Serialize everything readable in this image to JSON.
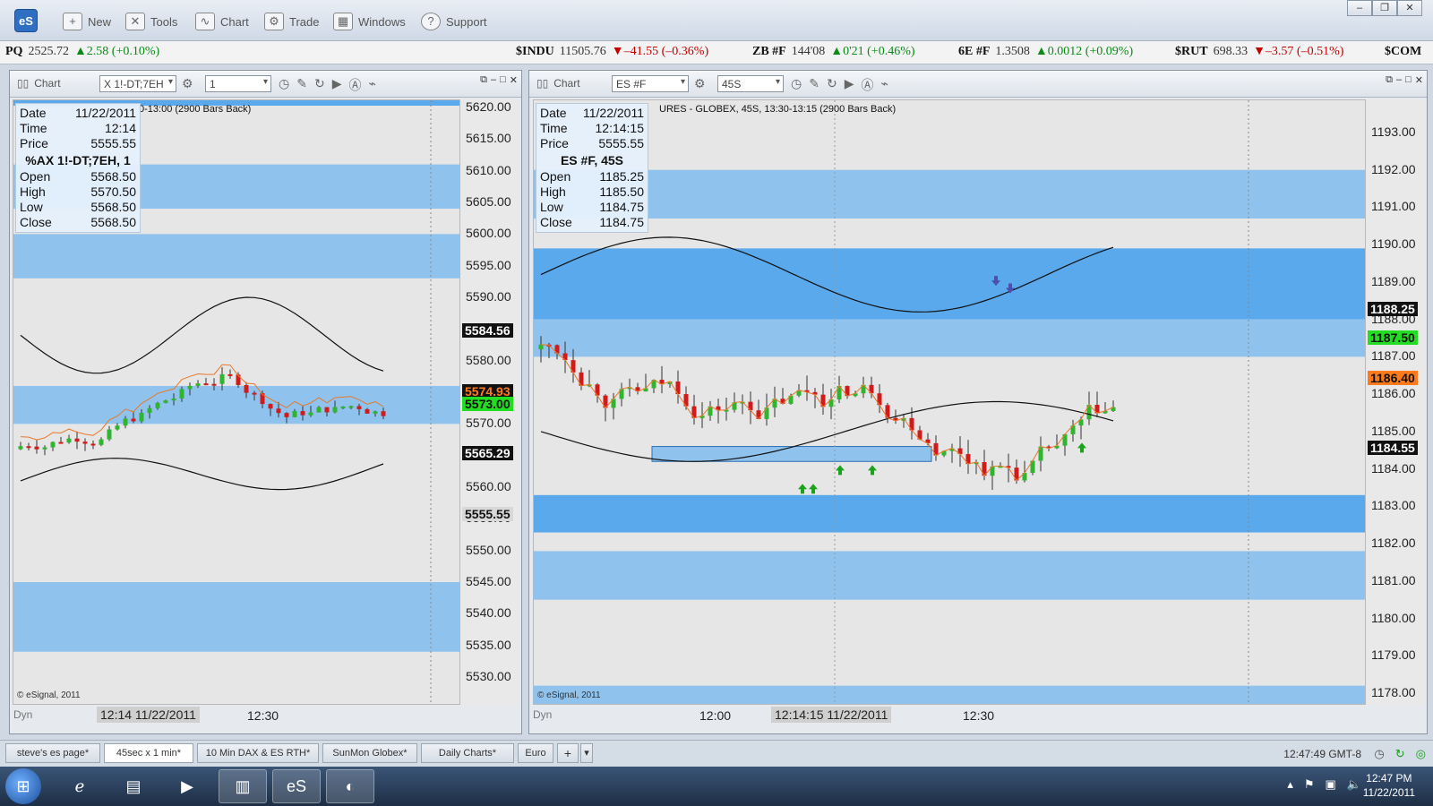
{
  "app": {
    "logo": "eS"
  },
  "toolbar": {
    "items": [
      {
        "label": "New",
        "icon": "new-icon"
      },
      {
        "label": "Tools",
        "icon": "tools-icon"
      },
      {
        "label": "Chart",
        "icon": "chart-icon"
      },
      {
        "label": "Trade",
        "icon": "trade-icon"
      },
      {
        "label": "Windows",
        "icon": "windows-icon"
      },
      {
        "label": "Support",
        "icon": "support-icon"
      }
    ]
  },
  "ticker": [
    {
      "sym": "PQ",
      "price": "2525.72",
      "dir": "up",
      "change": "▲2.58 (+0.10%)"
    },
    {
      "sym": "$INDU",
      "price": "11505.76",
      "dir": "down",
      "change": "▼–41.55 (–0.36%)"
    },
    {
      "sym": "ZB #F",
      "price": "144'08",
      "dir": "up",
      "change": "▲0'21 (+0.46%)"
    },
    {
      "sym": "6E #F",
      "price": "1.3508",
      "dir": "up",
      "change": "▲0.0012 (+0.09%)"
    },
    {
      "sym": "$RUT",
      "price": "698.33",
      "dir": "down",
      "change": "▼–3.57 (–0.51%)"
    },
    {
      "sym": "$COM",
      "price": "",
      "dir": "",
      "change": ""
    }
  ],
  "left_chart": {
    "header_label": "Chart",
    "symbol": "X 1!-DT;7EH",
    "interval": "1",
    "title_text": "0-13:00 (2900 Bars Back)",
    "info": {
      "date_label": "Date",
      "date": "11/22/2011",
      "time_label": "Time",
      "time": "12:14",
      "price_label": "Price",
      "price": "5555.55",
      "title": "%AX 1!-DT;7EH, 1",
      "open_label": "Open",
      "open": "5568.50",
      "high_label": "High",
      "high": "5570.50",
      "low_label": "Low",
      "low": "5568.50",
      "close_label": "Close",
      "close": "5568.50"
    },
    "copyright": "© eSignal, 2011",
    "dyn": "Dyn",
    "x_cursor": "12:14 11/22/2011",
    "x_label": "12:30",
    "y_labels": [
      "5620.00",
      "5615.00",
      "5610.00",
      "5605.00",
      "5600.00",
      "5595.00",
      "5590.00",
      "5585.00",
      "5580.00",
      "5575.00",
      "5570.00",
      "5565.00",
      "5560.00",
      "5555.00",
      "5550.00",
      "5545.00",
      "5540.00",
      "5535.00",
      "5530.00"
    ],
    "tags": [
      {
        "text": "5584.56",
        "bg": "#111111",
        "fg": "#ffffff",
        "value": 5584.56
      },
      {
        "text": "5574.93",
        "bg": "#111111",
        "fg": "#ff7a1a",
        "value": 5574.93
      },
      {
        "text": "5573.00",
        "bg": "#22dd22",
        "fg": "#111111",
        "value": 5573.0
      },
      {
        "text": "5565.29",
        "bg": "#111111",
        "fg": "#ffffff",
        "value": 5565.29
      },
      {
        "text": "5555.55",
        "bg": "#d8d8d8",
        "fg": "#111111",
        "value": 5555.55
      }
    ]
  },
  "right_chart": {
    "header_label": "Chart",
    "symbol": "ES #F",
    "interval": "45S",
    "title_text": "URES - GLOBEX, 45S, 13:30-13:15 (2900 Bars Back)",
    "info": {
      "date_label": "Date",
      "date": "11/22/2011",
      "time_label": "Time",
      "time": "12:14:15",
      "price_label": "Price",
      "price": "5555.55",
      "title": "ES #F, 45S",
      "open_label": "Open",
      "open": "1185.25",
      "high_label": "High",
      "high": "1185.50",
      "low_label": "Low",
      "low": "1184.75",
      "close_label": "Close",
      "close": "1184.75"
    },
    "copyright": "© eSignal, 2011",
    "dyn": "Dyn",
    "x_label_1": "12:00",
    "x_cursor": "12:14:15 11/22/2011",
    "x_label_2": "12:30",
    "y_labels": [
      "1193.00",
      "1192.00",
      "1191.00",
      "1190.00",
      "1189.00",
      "1188.00",
      "1187.00",
      "1186.00",
      "1185.00",
      "1184.00",
      "1183.00",
      "1182.00",
      "1181.00",
      "1180.00",
      "1179.00",
      "1178.00"
    ],
    "tags": [
      {
        "text": "1188.25",
        "bg": "#111111",
        "fg": "#ffffff",
        "value": 1188.25
      },
      {
        "text": "1187.50",
        "bg": "#22dd22",
        "fg": "#111111",
        "value": 1187.5
      },
      {
        "text": "1186.40",
        "bg": "#ff7a1a",
        "fg": "#111111",
        "value": 1186.4
      },
      {
        "text": "1184.55",
        "bg": "#111111",
        "fg": "#ffffff",
        "value": 1184.55
      }
    ]
  },
  "tabs": [
    "steve's es page*",
    "45sec x 1 min*",
    "10 Min DAX & ES RTH*",
    "SunMon Globex*",
    "Daily Charts*",
    "Euro",
    "+"
  ],
  "active_tab": 1,
  "status_time": "12:47:49 GMT-8",
  "taskbar": {
    "time": "12:47 PM",
    "date": "11/22/2011"
  },
  "colors": {
    "band": "#8fc3ee",
    "band_dark": "#5aa9ec",
    "up": "#2fb52f",
    "down": "#d11b1b"
  }
}
